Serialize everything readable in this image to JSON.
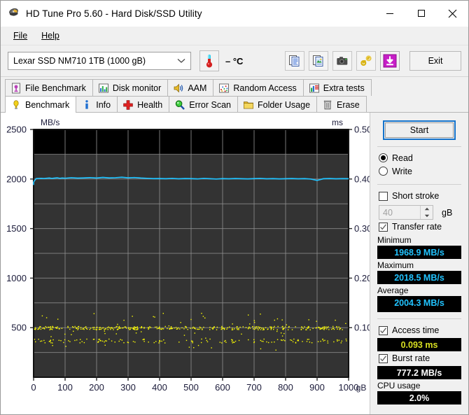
{
  "window": {
    "title": "HD Tune Pro 5.60 - Hard Disk/SSD Utility",
    "icon": "harddisk-icon",
    "minimize": "minimize-icon",
    "maximize": "maximize-icon",
    "close": "close-icon"
  },
  "menu": {
    "items": [
      {
        "label": "File"
      },
      {
        "label": "Help"
      }
    ]
  },
  "toolbar": {
    "device": "Lexar SSD NM710 1TB (1000 gB)",
    "device_options": [
      "Lexar SSD NM710 1TB (1000 gB)"
    ],
    "temperature": "– °C",
    "buttons": [
      {
        "name": "copy-text-button",
        "icon": "copy-text-icon"
      },
      {
        "name": "copy-image-button",
        "icon": "copy-image-icon"
      },
      {
        "name": "screenshot-button",
        "icon": "camera-icon"
      },
      {
        "name": "link-button",
        "icon": "chain-link-icon"
      },
      {
        "name": "save-button",
        "icon": "download-arrow-icon"
      }
    ],
    "exit_label": "Exit"
  },
  "tabs": {
    "row1": [
      {
        "label": "File Benchmark",
        "icon": "file-benchmark-icon",
        "active": false
      },
      {
        "label": "Disk monitor",
        "icon": "disk-monitor-icon",
        "active": false
      },
      {
        "label": "AAM",
        "icon": "speaker-icon",
        "active": false
      },
      {
        "label": "Random Access",
        "icon": "random-access-icon",
        "active": false
      },
      {
        "label": "Extra tests",
        "icon": "extra-tests-icon",
        "active": false
      }
    ],
    "row2": [
      {
        "label": "Benchmark",
        "icon": "benchmark-icon",
        "active": true
      },
      {
        "label": "Info",
        "icon": "info-icon",
        "active": false
      },
      {
        "label": "Health",
        "icon": "health-cross-icon",
        "active": false
      },
      {
        "label": "Error Scan",
        "icon": "magnifier-icon",
        "active": false
      },
      {
        "label": "Folder Usage",
        "icon": "folder-icon",
        "active": false
      },
      {
        "label": "Erase",
        "icon": "trash-icon",
        "active": false
      }
    ]
  },
  "panel": {
    "start_label": "Start",
    "mode": {
      "read_label": "Read",
      "write_label": "Write",
      "selected": "Read"
    },
    "short_stroke": {
      "label": "Short stroke",
      "checked": false,
      "value": "40",
      "unit": "gB"
    },
    "transfer_rate": {
      "label": "Transfer rate",
      "checked": true,
      "minimum_label": "Minimum",
      "minimum_value": "1968.9 MB/s",
      "maximum_label": "Maximum",
      "maximum_value": "2018.5 MB/s",
      "average_label": "Average",
      "average_value": "2004.3 MB/s"
    },
    "access_time": {
      "label": "Access time",
      "checked": true,
      "value": "0.093 ms"
    },
    "burst_rate": {
      "label": "Burst rate",
      "checked": true,
      "value": "777.2 MB/s"
    },
    "cpu_usage": {
      "label": "CPU usage",
      "value": "2.0%"
    },
    "colors": {
      "transfer": "#21c3ff",
      "access": "#d9e021",
      "plain": "#ffffff",
      "focus": "#1573cb"
    }
  },
  "chart_data": {
    "type": "line",
    "title": "",
    "ylabel": "MB/s",
    "y2label": "ms",
    "xlabel": "gB",
    "x_tick_labels": [
      "0",
      "100",
      "200",
      "300",
      "400",
      "500",
      "600",
      "700",
      "800",
      "900",
      "1000"
    ],
    "x": [
      0,
      100,
      200,
      300,
      400,
      500,
      600,
      700,
      800,
      900,
      1000
    ],
    "xlim": [
      0,
      1000
    ],
    "y_tick_labels": [
      "2500",
      "2000",
      "1500",
      "1000",
      "500"
    ],
    "ylim": [
      0,
      2500
    ],
    "y2_tick_labels": [
      "0.50",
      "0.40",
      "0.30",
      "0.20",
      "0.10"
    ],
    "y2lim": [
      0,
      0.5
    ],
    "grid": true,
    "plot_background": "#000000",
    "legend": "none",
    "series": [
      {
        "name": "Transfer rate",
        "color": "#21c3ff",
        "axis": "left",
        "unit": "MB/s",
        "style": "line",
        "x": [
          0,
          8,
          16,
          25,
          33,
          41,
          50,
          58,
          66,
          75,
          83,
          91,
          100,
          120,
          140,
          160,
          180,
          200,
          220,
          240,
          260,
          280,
          300,
          320,
          340,
          360,
          380,
          400,
          420,
          440,
          460,
          480,
          500,
          520,
          540,
          560,
          580,
          600,
          620,
          640,
          660,
          680,
          700,
          720,
          740,
          760,
          780,
          800,
          820,
          840,
          860,
          880,
          900,
          920,
          940,
          960,
          980,
          1000
        ],
        "values": [
          1971,
          2004,
          2006,
          2007,
          2005,
          2008,
          2010,
          2006,
          2009,
          2012,
          2007,
          2010,
          2008,
          2013,
          2009,
          2011,
          2014,
          2010,
          2016,
          2011,
          2013,
          2018,
          2012,
          2015,
          2010,
          2007,
          2004,
          2005,
          2003,
          2006,
          2002,
          2005,
          2004,
          2001,
          2006,
          2003,
          2000,
          2004,
          2002,
          2005,
          2003,
          2001,
          2004,
          2006,
          2002,
          2004,
          2001,
          2003,
          2005,
          2002,
          2004,
          2000,
          1986,
          2003,
          2005,
          2002,
          2004,
          2003
        ]
      },
      {
        "name": "Access time",
        "color": "#ffff00",
        "axis": "right",
        "unit": "ms",
        "style": "scatter",
        "band_primary_ms": 0.1,
        "band_secondary_ms": 0.074,
        "outlier_ms_range": [
          0.055,
          0.13
        ],
        "point_count": 520
      }
    ]
  }
}
